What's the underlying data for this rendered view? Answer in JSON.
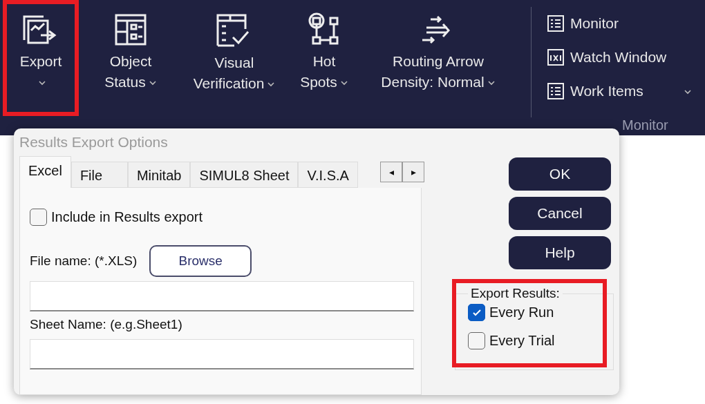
{
  "ribbon": {
    "commands": [
      {
        "label": "Export",
        "has_dropdown": true,
        "highlighted": true
      },
      {
        "label": "Object Status",
        "has_dropdown": true,
        "highlighted": false
      },
      {
        "label": "Visual Verification",
        "has_dropdown": true,
        "highlighted": false
      },
      {
        "label": "Hot Spots",
        "has_dropdown": true,
        "highlighted": false
      },
      {
        "label": "Routing Arrow Density: Normal",
        "has_dropdown": true,
        "highlighted": false
      }
    ],
    "monitor_items": [
      {
        "label": "Monitor",
        "has_dropdown": false
      },
      {
        "label": "Watch Window",
        "has_dropdown": false
      },
      {
        "label": "Work Items",
        "has_dropdown": true
      }
    ],
    "monitor_group_label": "Monitor"
  },
  "dialog": {
    "title": "Results Export Options",
    "tabs": [
      {
        "label": "Excel",
        "selected": true
      },
      {
        "label": "File",
        "selected": false
      },
      {
        "label": "Minitab",
        "selected": false
      },
      {
        "label": "SIMUL8 Sheet",
        "selected": false
      },
      {
        "label": "V.I.S.A",
        "selected": false
      }
    ],
    "scroll_buttons": [
      "◂",
      "▸"
    ],
    "include_checkbox": {
      "label": "Include in Results export",
      "checked": false
    },
    "file_name_label": "File name: (*.XLS)",
    "browse_button": "Browse",
    "sheet_name_label": "Sheet Name: (e.g.Sheet1)",
    "buttons": [
      "OK",
      "Cancel",
      "Help"
    ],
    "export_results": {
      "title": "Export Results:",
      "highlighted": true,
      "options": [
        {
          "label": "Every Run",
          "checked": true
        },
        {
          "label": "Every Trial",
          "checked": false
        }
      ]
    }
  }
}
